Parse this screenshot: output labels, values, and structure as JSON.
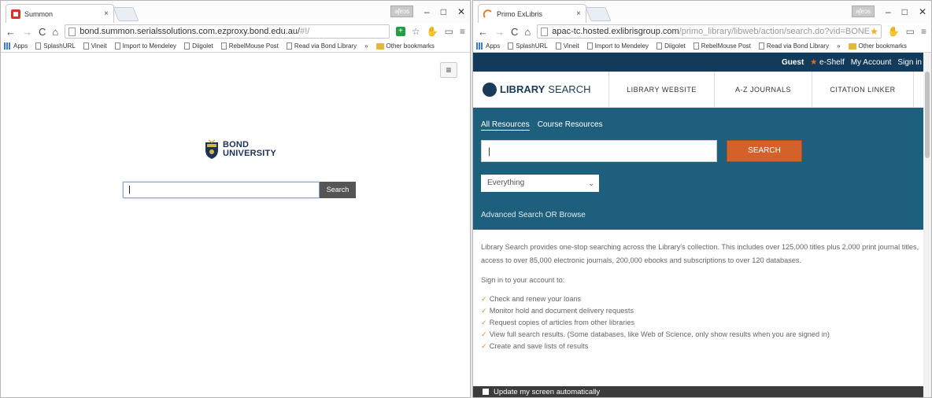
{
  "left_window": {
    "tab_title": "Summon",
    "tab_close": "×",
    "window_controls": {
      "badge": "ǝʃɐɔs",
      "minimize": "–",
      "maximize": "□",
      "close": "✕"
    },
    "url_main": "bond.summon.serialssolutions.com.ezproxy.bond.edu.au/",
    "url_dim": "#!/",
    "bookmarks": [
      "Apps",
      "SplashURL",
      "Vineit",
      "Import to Mendeley",
      "Diigolet",
      "RebelMouse Post",
      "Read via Bond Library",
      "»",
      "Other bookmarks"
    ],
    "logo_line1": "BOND",
    "logo_line2": "UNIVERSITY",
    "search_value": "|",
    "search_button": "Search"
  },
  "right_window": {
    "tab_title": "Primo ExLibris",
    "tab_close": "×",
    "window_controls": {
      "badge": "ǝʃɐɔs",
      "minimize": "–",
      "maximize": "□",
      "close": "✕"
    },
    "url_main": "apac-tc.hosted.exlibrisgroup.com",
    "url_dim": "/primo_library/libweb/action/search.do?vid=BONE",
    "bookmarks": [
      "Apps",
      "SplashURL",
      "Vineit",
      "Import to Mendeley",
      "Diigolet",
      "RebelMouse Post",
      "Read via Bond Library",
      "»",
      "Other bookmarks"
    ],
    "topbar": {
      "guest": "Guest",
      "eshelf": "e-Shelf",
      "account": "My Account",
      "signin": "Sign in"
    },
    "logo_bold": "LIBRARY",
    "logo_light": "SEARCH",
    "nav": [
      "LIBRARY WEBSITE",
      "A-Z JOURNALS",
      "CITATION LINKER"
    ],
    "tabs": [
      "All Resources",
      "Course Resources"
    ],
    "search_value": "|",
    "search_button": "SEARCH",
    "scope": "Everything",
    "advanced": "Advanced Search",
    "or": "OR",
    "browse": "Browse",
    "intro": "Library Search provides one-stop searching across the Library's collection. This includes over 125,000 titles plus 2,000 print journal titles, access to over 85,000 electronic journals, 200,000 ebooks and subscriptions to over 120 databases.",
    "signin_prompt": "Sign in to your account to:",
    "benefits": [
      "Check and renew your loans",
      "Monitor hold and document delivery requests",
      "Request copies of articles from other libraries",
      "View full search results. (Some databases, like Web of Science, only show results when you are signed in)",
      "Create and save lists of results"
    ],
    "update_label": "Update my screen automatically"
  },
  "colors": {
    "primo_blue": "#1d5f7d",
    "primo_dark": "#123a5a",
    "primo_orange": "#d4602a",
    "bond_navy": "#1d2f5c"
  }
}
